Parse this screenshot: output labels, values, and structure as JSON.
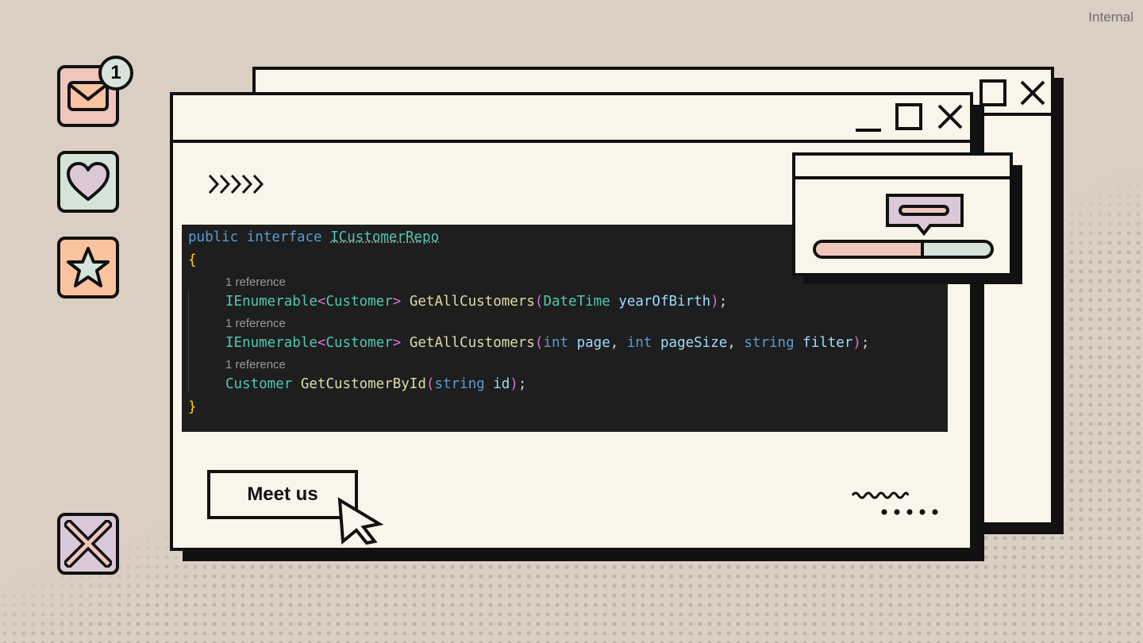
{
  "label": "Internal",
  "notification_count": "1",
  "code": {
    "line1": {
      "kw1": "public",
      "kw2": "interface",
      "name": "ICustomerRepo"
    },
    "open_brace": "{",
    "close_brace": "}",
    "refs": [
      "1 reference",
      "1 reference",
      "1 reference"
    ],
    "method1": {
      "ret": "IEnumerable",
      "lt": "<",
      "gen": "Customer",
      "gt": ">",
      "name": "GetAllCustomers",
      "lp": "(",
      "ptype": "DateTime",
      "pname": "yearOfBirth",
      "rp": ")",
      "end": ";"
    },
    "method2": {
      "ret": "IEnumerable",
      "lt": "<",
      "gen": "Customer",
      "gt": ">",
      "name": "GetAllCustomers",
      "lp": "(",
      "t1": "int",
      "p1": "page",
      "c1": ",",
      "t2": "int",
      "p2": "pageSize",
      "c2": ",",
      "t3": "string",
      "p3": "filter",
      "rp": ")",
      "end": ";"
    },
    "method3": {
      "ret": "Customer",
      "name": "GetCustomerById",
      "lp": "(",
      "t1": "string",
      "p1": "id",
      "rp": ")",
      "end": ";"
    }
  },
  "button": {
    "label": "Meet us"
  },
  "progress": {
    "fraction": 0.6
  },
  "colors": {
    "background": "#dbcfc3",
    "window": "#faf5ea",
    "pink": "#efc5bc",
    "mint": "#d6e3d8",
    "lilac": "#dac8d8",
    "peach": "#f9c3a0",
    "code_bg": "#1e1e1e"
  },
  "icons": [
    "mail-icon",
    "heart-icon",
    "star-icon",
    "close-icon",
    "chevrons-right-icon",
    "cursor-icon",
    "minimize-icon",
    "maximize-icon",
    "message-icon"
  ]
}
